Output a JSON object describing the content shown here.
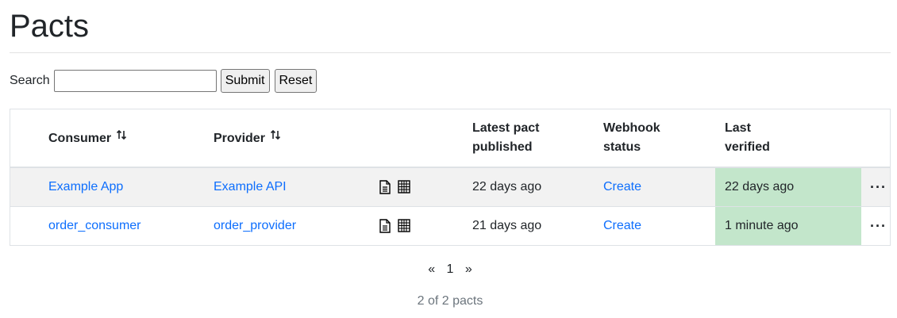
{
  "page": {
    "title": "Pacts"
  },
  "search": {
    "label": "Search",
    "value": "",
    "submit_label": "Submit",
    "reset_label": "Reset"
  },
  "table": {
    "headers": {
      "consumer": "Consumer",
      "provider": "Provider",
      "latest_line1": "Latest pact",
      "latest_line2": "published",
      "webhook_line1": "Webhook",
      "webhook_line2": "status",
      "verified_line1": "Last",
      "verified_line2": "verified"
    },
    "rows": [
      {
        "consumer": "Example App",
        "provider": "Example API",
        "published": "22 days ago",
        "webhook": "Create",
        "verified": "22 days ago"
      },
      {
        "consumer": "order_consumer",
        "provider": "order_provider",
        "published": "21 days ago",
        "webhook": "Create",
        "verified": "1 minute ago"
      }
    ],
    "row_menu": "···"
  },
  "icons": {
    "sort": "sort-arrows-icon",
    "doc": "document-icon",
    "matrix": "matrix-grid-icon",
    "menu": "more-options-icon"
  },
  "pagination": {
    "prev": "«",
    "page": "1",
    "next": "»"
  },
  "summary": "2 of 2 pacts",
  "colors": {
    "link": "#0d6efd",
    "verified_bg": "#c3e6cb",
    "row_stripe": "#f2f2f2"
  }
}
